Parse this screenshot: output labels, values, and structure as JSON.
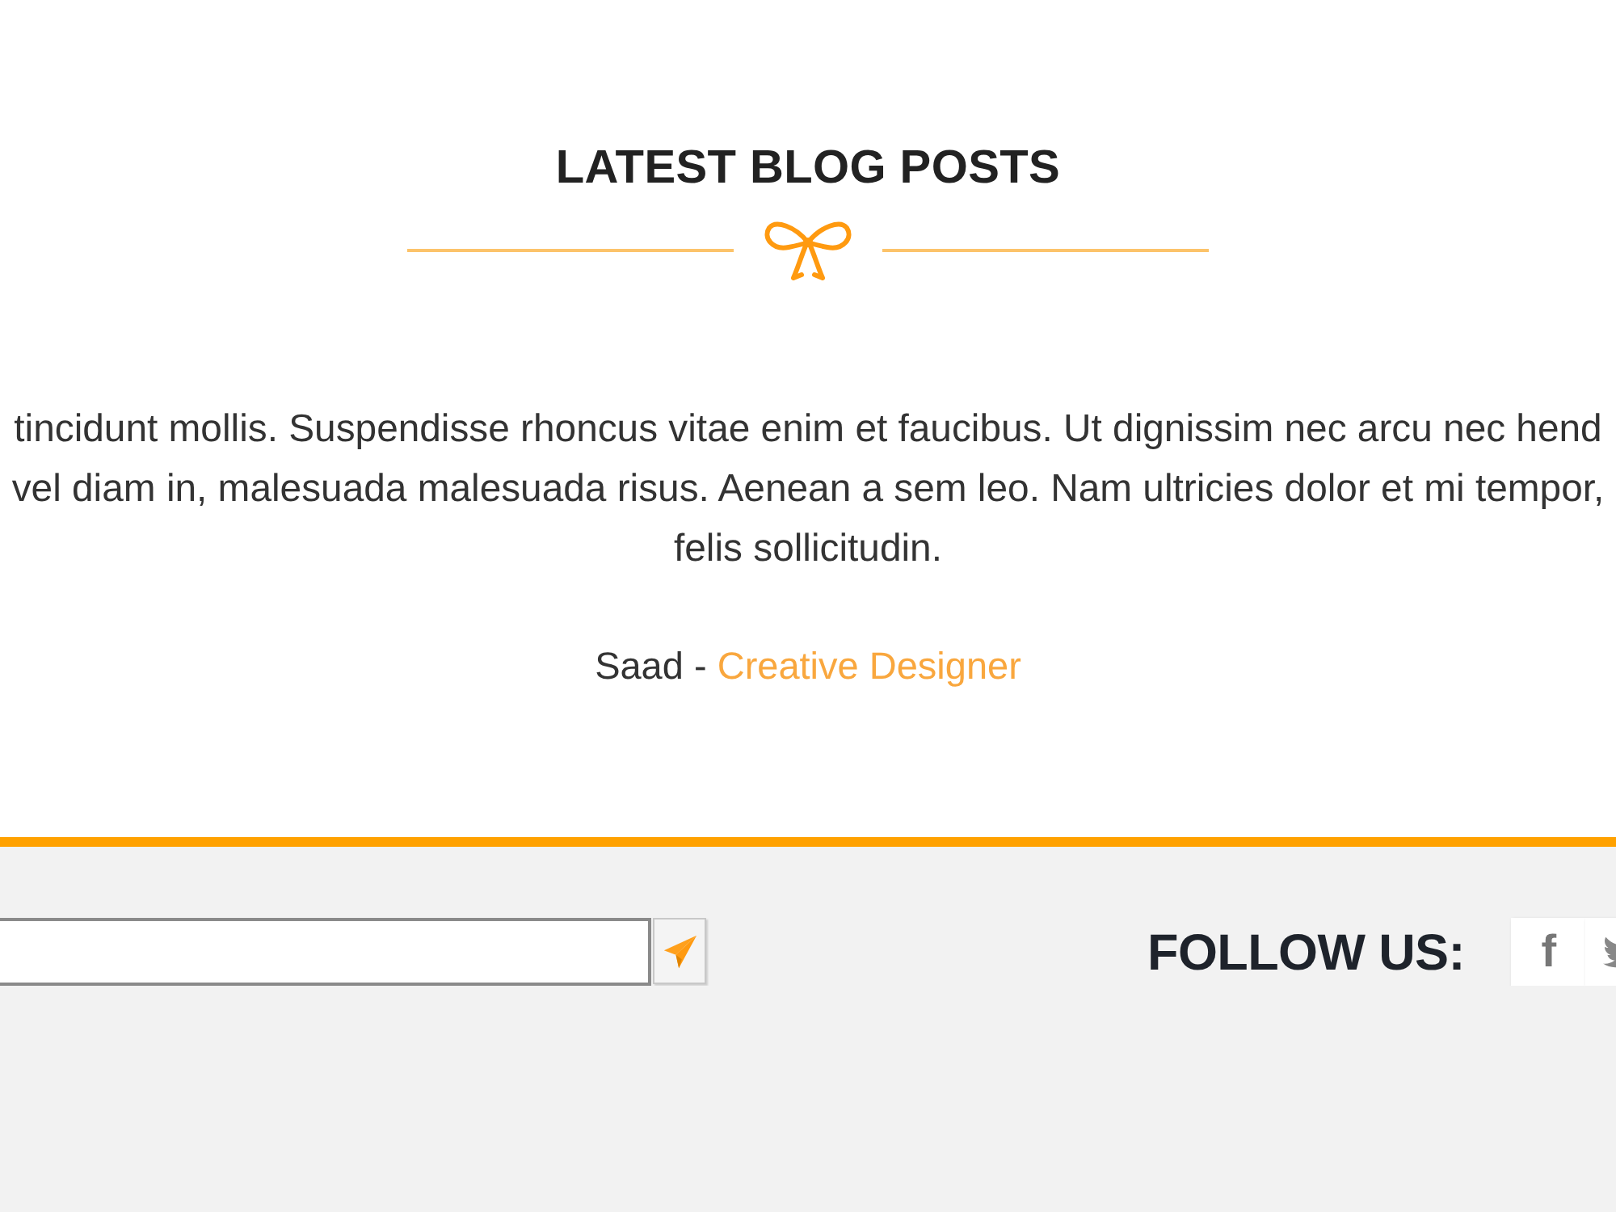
{
  "section": {
    "title": "LATEST BLOG POSTS"
  },
  "testimonial": {
    "lines": [
      "tincidunt mollis. Suspendisse rhoncus vitae enim et faucibus. Ut dignissim nec arcu nec hend",
      "vel diam in, malesuada malesuada risus. Aenean a sem leo. Nam ultricies dolor et mi tempor,",
      "felis sollicitudin."
    ],
    "author": "Saad",
    "separator": "-",
    "role": "Creative Designer"
  },
  "footer": {
    "follow_title": "FOLLOW US:",
    "social": [
      {
        "kind": "facebook",
        "glyph": "f"
      },
      {
        "kind": "twitter"
      }
    ]
  }
}
